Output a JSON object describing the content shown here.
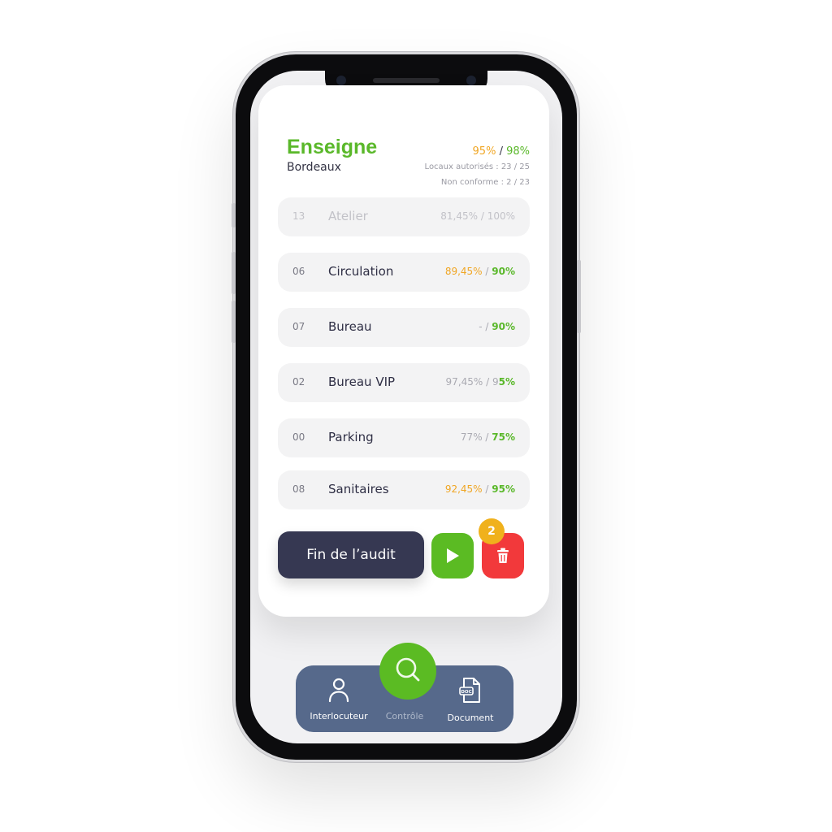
{
  "header": {
    "brand": "Enseigne",
    "city": "Bordeaux",
    "score_current": "95%",
    "score_separator": " / ",
    "score_target": "98%",
    "locaux": "Locaux autorisés : 23 / 25",
    "non_conforme": "Non conforme : 2 / 23"
  },
  "rows": [
    {
      "num": "13",
      "name": "Atelier",
      "pct_current": "81,45%",
      "sep": " / ",
      "pct_target": "100%"
    },
    {
      "num": "06",
      "name": "Circulation",
      "pct_current": "89,45%",
      "sep": " / ",
      "pct_target": "90%"
    },
    {
      "num": "07",
      "name": "Bureau",
      "pct_current": "-",
      "sep": " / ",
      "pct_target": "90%"
    },
    {
      "num": "02",
      "name": "Bureau VIP",
      "pct_current": "97,45%",
      "sep": " / 9",
      "pct_target": "5%"
    },
    {
      "num": "00",
      "name": "Parking",
      "pct_current": "77%",
      "sep": " / ",
      "pct_target": "75%"
    },
    {
      "num": "08",
      "name": "Sanitaires",
      "pct_current": "92,45%",
      "sep": " / ",
      "pct_target": "95%"
    }
  ],
  "actions": {
    "fin_label": "Fin de l’audit",
    "badge_count": "2"
  },
  "nav": {
    "interlocuteur": "Interlocuteur",
    "controle": "Contrôle",
    "document": "Document",
    "doc_tag": "DOC"
  },
  "colors": {
    "green": "#5ab82a",
    "orange": "#f0a624",
    "navy": "#363852",
    "red": "#f2393b",
    "nav_blue": "#56698b"
  },
  "icons": [
    "user-icon",
    "search-icon",
    "document-icon",
    "play-icon",
    "trash-icon"
  ]
}
